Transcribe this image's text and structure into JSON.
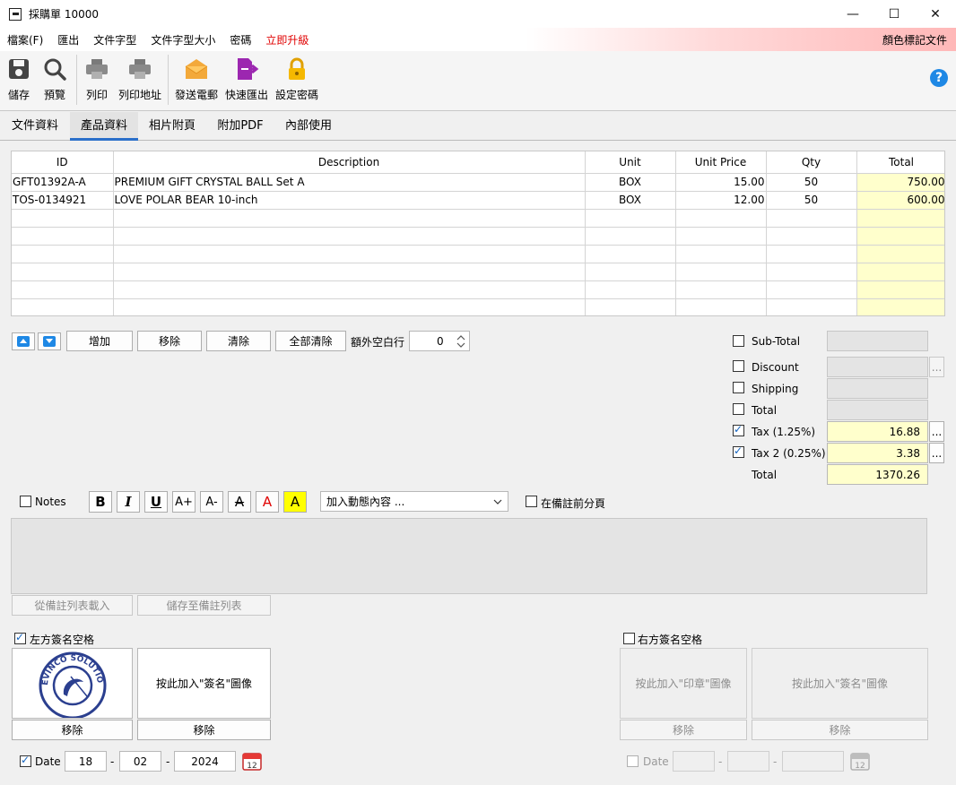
{
  "window": {
    "title": "採購單 10000"
  },
  "menu": {
    "items": [
      "檔案(F)",
      "匯出",
      "文件字型",
      "文件字型大小",
      "密碼"
    ],
    "upgrade": "立即升級",
    "right": "顏色標記文件"
  },
  "toolbar": {
    "save": "儲存",
    "preview": "預覽",
    "print": "列印",
    "print_address": "列印地址",
    "send_email": "發送電郵",
    "quick_export": "快速匯出",
    "set_password": "設定密碼"
  },
  "tabs": [
    "文件資料",
    "產品資料",
    "相片附頁",
    "附加PDF",
    "內部使用"
  ],
  "grid": {
    "headers": [
      "ID",
      "Description",
      "Unit",
      "Unit Price",
      "Qty",
      "Total"
    ],
    "rows": [
      [
        "GFT01392A-A",
        "PREMIUM GIFT CRYSTAL BALL Set A",
        "BOX",
        "15.00",
        "50",
        "750.00"
      ],
      [
        "TOS-0134921",
        "LOVE POLAR BEAR 10-inch",
        "BOX",
        "12.00",
        "50",
        "600.00"
      ]
    ]
  },
  "actions": {
    "add": "增加",
    "remove": "移除",
    "clear": "清除",
    "clear_all": "全部清除",
    "extra_rows_label": "額外空白行",
    "extra_rows_value": "0"
  },
  "summary": {
    "subtotal": "Sub-Total",
    "discount": "Discount",
    "shipping": "Shipping",
    "total_cb": "Total",
    "tax1": "Tax (1.25%)",
    "tax1_value": "16.88",
    "tax2": "Tax 2 (0.25%)",
    "tax2_value": "3.38",
    "total": "Total",
    "total_value": "1370.26",
    "more": "..."
  },
  "notes": {
    "label": "Notes",
    "dynamic": "加入動態內容 ...",
    "page_break": "在備註前分頁",
    "load": "從備註列表載入",
    "save": "儲存至備註列表"
  },
  "fmt": {
    "bold": "B",
    "italic": "I",
    "underline": "U",
    "grow": "A+",
    "shrink": "A-",
    "strike": "A",
    "color": "A",
    "highlight": "A"
  },
  "sign": {
    "left_label": "左方簽名空格",
    "right_label": "右方簽名空格",
    "add_signature": "按此加入\"簽名\"圖像",
    "add_stamp": "按此加入\"印章\"圖像",
    "remove": "移除",
    "stamp_text": "EVINCO SOLUTIONS LIMITED",
    "date_label": "Date",
    "day": "18",
    "month": "02",
    "year": "2024",
    "dash": "-",
    "cal": "12"
  },
  "colors": {
    "accent": "#2a6fc9",
    "highlight": "#ffffcc",
    "upgrade": "#e00000"
  }
}
